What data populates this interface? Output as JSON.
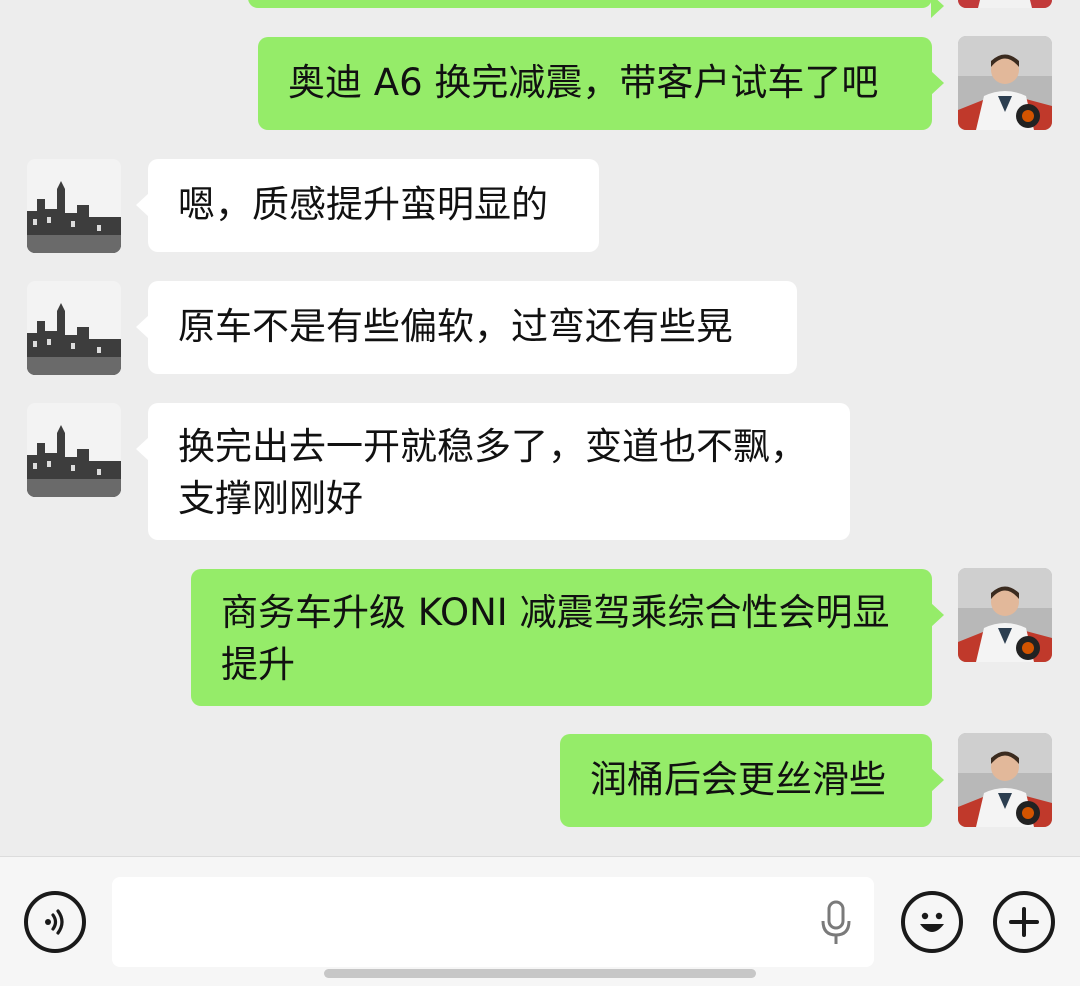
{
  "messages": [
    {
      "side": "out",
      "text": "奥迪 A6 换完减震，带客户试车了吧"
    },
    {
      "side": "in",
      "text": "嗯，质感提升蛮明显的"
    },
    {
      "side": "in",
      "text": "原车不是有些偏软，过弯还有些晃"
    },
    {
      "side": "in",
      "line1": "换完出去一开就稳多了，变道也不飘，",
      "line2": "支撑刚刚好"
    },
    {
      "side": "out",
      "line1": "商务车升级 KONI 减震驾乘综合性会明显",
      "line2": "提升"
    },
    {
      "side": "out",
      "text": "润桶后会更丝滑些"
    }
  ],
  "toolbar": {
    "voice_icon": "voice-icon",
    "mic_icon": "microphone-icon",
    "emoji_icon": "emoji-icon",
    "plus_icon": "plus-icon"
  },
  "colors": {
    "outgoing_bubble": "#95ec69",
    "incoming_bubble": "#ffffff",
    "background": "#ededed"
  }
}
